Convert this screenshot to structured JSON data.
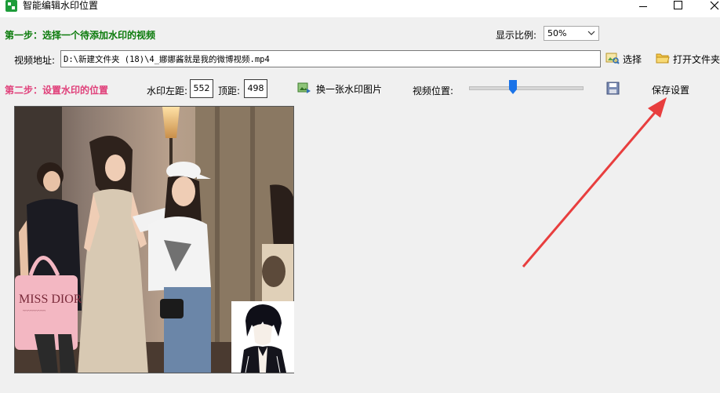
{
  "window": {
    "title": "智能编辑水印位置",
    "icon": "app-logo-icon",
    "controls": [
      "minimize-icon",
      "maximize-icon",
      "close-icon"
    ]
  },
  "step1": {
    "label": "第一步：选择一个待添加水印的视频",
    "color": "#0a7a0a",
    "scale_label": "显示比例:",
    "scale_value": "50%",
    "video_label": "视频地址:",
    "video_path": "D:\\新建文件夹 (18)\\4_娜娜酱就是我的微博视频.mp4",
    "select_label": "选择",
    "open_folder_label": "打开文件夹"
  },
  "step2": {
    "label": "第二步：设置水印的位置",
    "color": "#e0407a",
    "left_label": "水印左距:",
    "left_value": "552",
    "top_label": "顶距:",
    "top_value": "498",
    "replace_label": "换一张水印图片",
    "position_label": "视频位置:",
    "position_fraction": 0.39,
    "save_settings_label": "保存设置"
  },
  "preview": {
    "poster_text_line1": "MISS DIOR",
    "poster_text_line2": "~~~~~~~~~",
    "accent_color": "#e83e3e"
  }
}
